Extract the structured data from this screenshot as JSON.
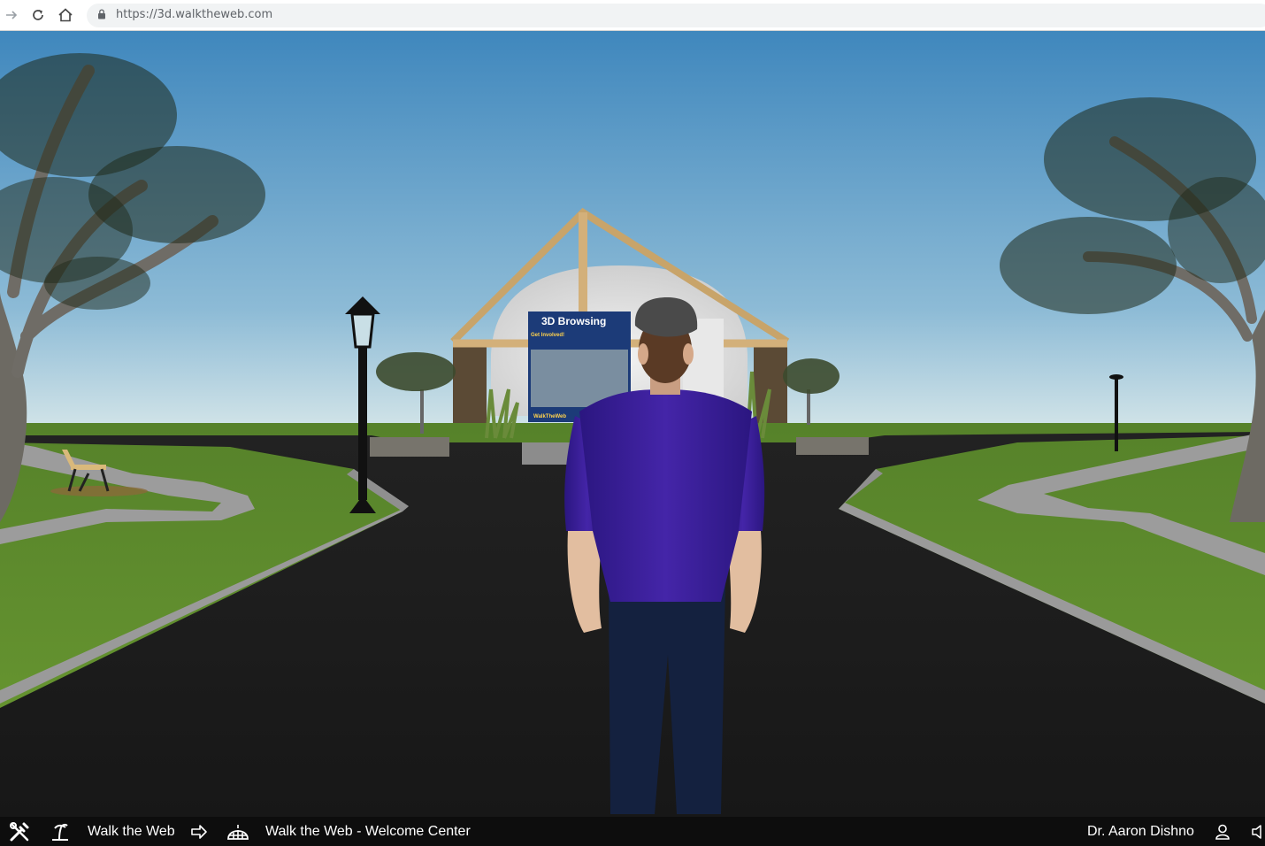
{
  "browser": {
    "url": "https://3d.walktheweb.com",
    "icons": [
      "forward-arrow-icon",
      "reload-icon",
      "home-icon",
      "lock-icon"
    ]
  },
  "scene": {
    "sign_text": "3D Browsing",
    "sign_sub": "Get Involved!",
    "sign_brand": "WalkTheWeb"
  },
  "toolbar": {
    "site_label": "Walk the Web",
    "community_label": "Walk the Web - Welcome Center",
    "user_name": "Dr. Aaron Dishno"
  },
  "colors": {
    "sky_top": "#3f87bd",
    "sky_bottom": "#c6dce3",
    "grass": "#5f8a2c",
    "road": "#1b1b1b",
    "shirt": "#3a1f96",
    "toolbar_bg": "#0d0d0d"
  }
}
